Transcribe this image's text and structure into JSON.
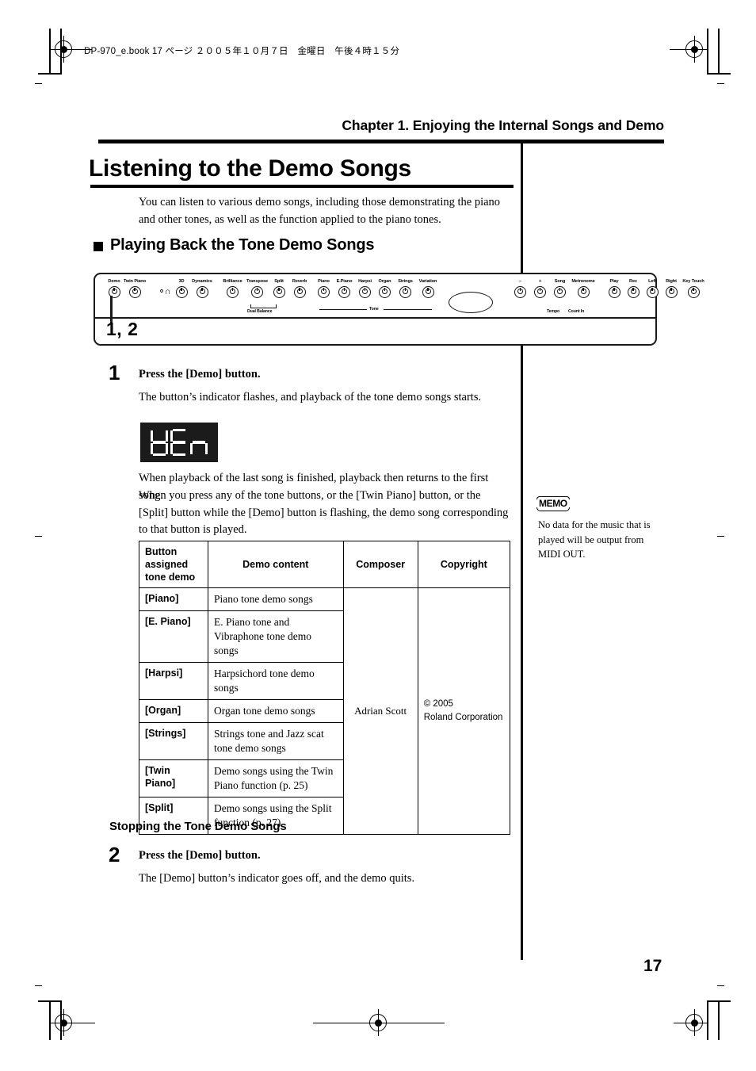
{
  "print_header": {
    "text": "DP-970_e.book  17 ページ  ２００５年１０月７日　金曜日　午後４時１５分"
  },
  "chapter": {
    "title": "Chapter 1. Enjoying the Internal Songs and Demo"
  },
  "section": {
    "title": "Listening to the Demo Songs",
    "intro": "You can listen to various demo songs, including those demonstrating the piano and other tones, as well as the function applied to the piano tones.",
    "subsection": "Playing Back the Tone Demo Songs"
  },
  "panel": {
    "callout_label": "1, 2",
    "left_buttons": [
      {
        "label": "Demo"
      },
      {
        "label": "Twin Piano"
      }
    ],
    "headphone_label": "",
    "headphone_icon": "headphone-icon",
    "mid_buttons": [
      {
        "label": "3D"
      },
      {
        "label": "Dynamics"
      }
    ],
    "effect_buttons": [
      {
        "label": "Brilliance"
      },
      {
        "label": "Transpose"
      },
      {
        "label": "Split"
      },
      {
        "label": "Reverb"
      }
    ],
    "dual_balance_label": "Dual Balance",
    "tone_buttons": [
      {
        "label": "Piano"
      },
      {
        "label": "E.Piano"
      },
      {
        "label": "Harpsi"
      },
      {
        "label": "Organ"
      },
      {
        "label": "Strings"
      },
      {
        "label": "Variation"
      }
    ],
    "tone_group_label": "Tone",
    "tempo_buttons": [
      {
        "label": "–"
      },
      {
        "label": "+"
      },
      {
        "label": "Song"
      },
      {
        "label": "Metronome"
      }
    ],
    "tempo_sub_label": "Tempo",
    "countin_sub_label": "Count In",
    "right_buttons": [
      {
        "label": "Play"
      },
      {
        "label": "Rec"
      },
      {
        "label": "Left"
      },
      {
        "label": "Right"
      },
      {
        "label": "Key Touch"
      }
    ]
  },
  "step1": {
    "number": "1",
    "heading": "Press the [Demo] button.",
    "body": "The button’s indicator flashes, and playback of the tone demo songs starts.",
    "display_value": "dEn",
    "note1": "When playback of the last song is finished, playback then returns to the first song.",
    "note2": "When you press any of the tone buttons, or the [Twin Piano] button, or the [Split] button while the [Demo] button is flashing, the demo song corresponding to that button is played."
  },
  "memo": {
    "badge": "MEMO",
    "text": "No data for the music that is played will be output from MIDI OUT."
  },
  "table": {
    "headers": [
      "Button assigned tone demo",
      "Demo content",
      "Composer",
      "Copyright"
    ],
    "composer": "Adrian Scott",
    "copyright": "© 2005\nRoland Corporation",
    "rows": [
      {
        "button": "[Piano]",
        "content": "Piano tone demo songs"
      },
      {
        "button": "[E. Piano]",
        "content": "E. Piano tone and Vibraphone tone demo songs"
      },
      {
        "button": "[Harpsi]",
        "content": "Harpsichord tone demo songs"
      },
      {
        "button": "[Organ]",
        "content": "Organ tone demo songs"
      },
      {
        "button": "[Strings]",
        "content": "Strings tone and Jazz scat tone demo songs"
      },
      {
        "button": "[Twin\nPiano]",
        "content": "Demo songs using the Twin Piano function (p. 25)"
      },
      {
        "button": "[Split]",
        "content": "Demo songs using the Split function (p. 27)"
      }
    ]
  },
  "stopping": {
    "subsection": "Stopping the Tone Demo Songs",
    "number": "2",
    "heading": "Press the [Demo] button.",
    "body": "The [Demo] button’s indicator goes off, and the demo quits."
  },
  "footer": {
    "page_number": "17"
  }
}
